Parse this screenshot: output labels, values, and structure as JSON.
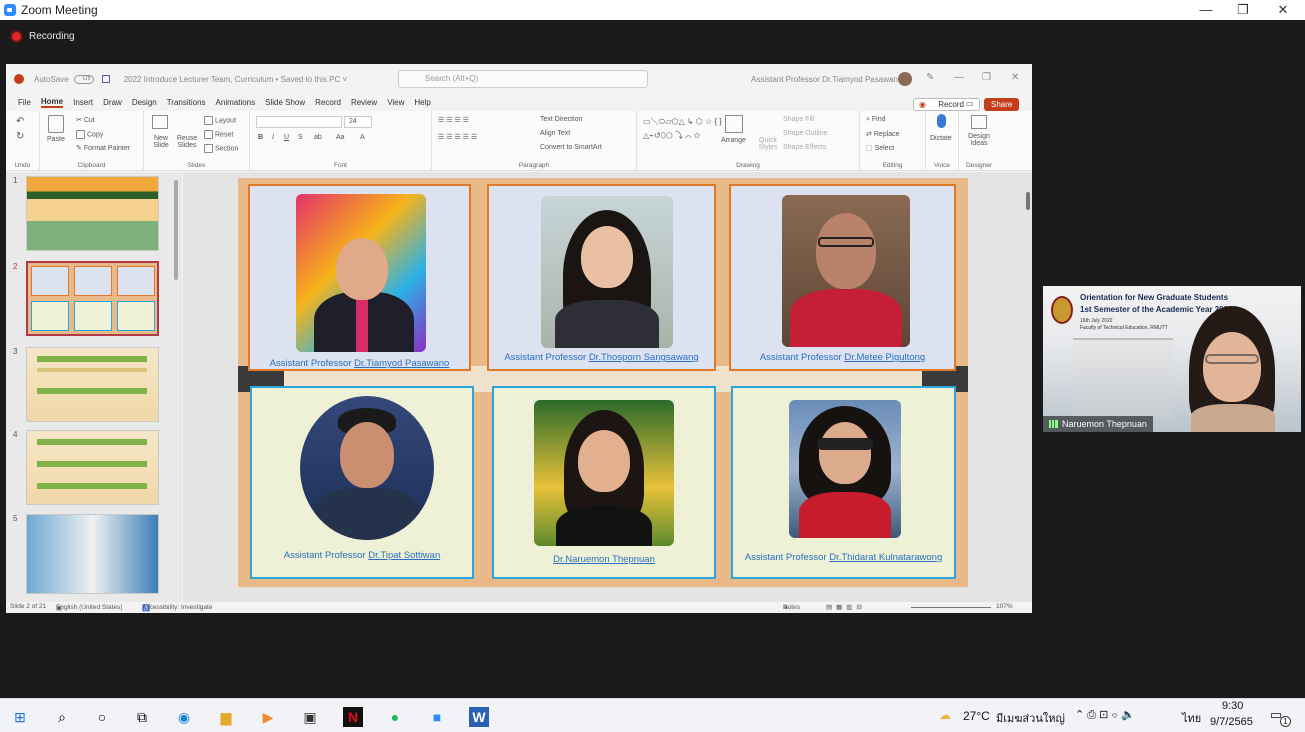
{
  "zoom": {
    "window_title": "Zoom Meeting",
    "recording_label": "Recording",
    "minimize": "—",
    "maximize": "❐",
    "close": "✕"
  },
  "ppt": {
    "autosave": "AutoSave",
    "toggle_state": "Off",
    "file_title": "2022 Introduce Lecturer Team, Curriculum • Saved to this PC ˅",
    "search_placeholder": "Search (Alt+Q)",
    "user_name": "Assistant Professor Dr.Tiamyod Pasawano",
    "menu": [
      "File",
      "Home",
      "Insert",
      "Draw",
      "Design",
      "Transitions",
      "Animations",
      "Slide Show",
      "Record",
      "Review",
      "View",
      "Help"
    ],
    "record_btn": "Record",
    "share_btn": "Share",
    "ribbon": {
      "undo": "Undo",
      "clipboard": "Clipboard",
      "paste": "Paste",
      "cut": "Cut",
      "copy": "Copy",
      "format_painter": "Format Painter",
      "new_slide": "New Slide",
      "reuse_slides": "Reuse Slides",
      "layout": "Layout",
      "reset": "Reset",
      "section": "Section",
      "slides": "Slides",
      "font_size": "24",
      "font": "Font",
      "paragraph": "Paragraph",
      "text_direction": "Text Direction",
      "align_text": "Align Text",
      "convert_smartart": "Convert to SmartArt",
      "drawing": "Drawing",
      "arrange": "Arrange",
      "quick_styles": "Quick Styles",
      "shape_fill": "Shape Fill",
      "shape_outline": "Shape Outline",
      "shape_effects": "Shape Effects",
      "find": "Find",
      "replace": "Replace",
      "select": "Select",
      "editing": "Editing",
      "dictate": "Dictate",
      "voice": "Voice",
      "design_ideas": "Design Ideas",
      "designer": "Designer"
    },
    "thumbnails": [
      "1",
      "2",
      "3",
      "4",
      "5"
    ],
    "slide_cards": [
      {
        "prefix": "Assistant Professor ",
        "name": "Dr.Tiamyod Pasawano"
      },
      {
        "prefix": "Assistant Professor ",
        "name": "Dr.Thosporn Sangsawang"
      },
      {
        "prefix": "Assistant Professor ",
        "name": "Dr.Metee Pigultong"
      },
      {
        "prefix": "Assistant Professor ",
        "name": "Dr.Tipat Sottiwan"
      },
      {
        "prefix": "",
        "name": "Dr.Naruemon Thepnuan"
      },
      {
        "prefix": "Assistant Professor ",
        "name": "Dr.Thidarat Kulnatarawong"
      }
    ],
    "status": {
      "slide": "Slide 2 of 21",
      "language": "English (United States)",
      "accessibility": "Accessibility: Investigate",
      "notes": "Notes",
      "zoom": "107%"
    }
  },
  "video": {
    "line1": "Orientation for New Graduate Students",
    "line2": "1st Semester of the Academic Year 2022",
    "line3": "16th July 2022",
    "line4": "Faculty of Technical Education, RMUTT",
    "participant": "Naruemon Thepnuan"
  },
  "taskbar": {
    "weather": "27°C",
    "weather_text": "มีเมฆส่วนใหญ่",
    "lang": "ไทย",
    "time": "9:30",
    "date": "9/7/2565",
    "notif": "1"
  }
}
